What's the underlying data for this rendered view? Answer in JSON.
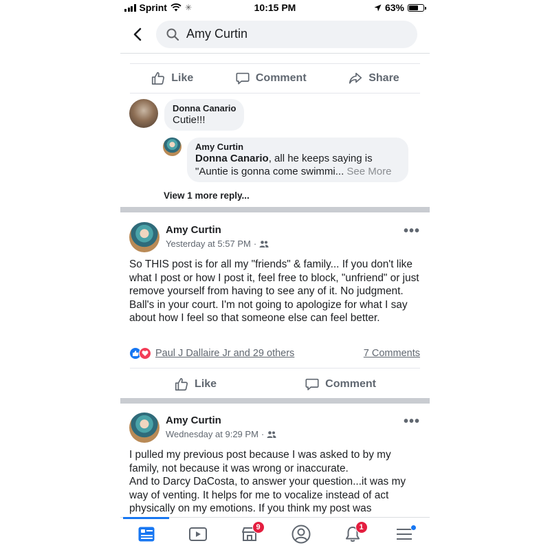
{
  "status_bar": {
    "carrier": "Sprint",
    "time": "10:15 PM",
    "battery": "63%",
    "battery_level": 0.63
  },
  "search": {
    "query": "Amy Curtin"
  },
  "top_post": {
    "actions": {
      "like": "Like",
      "comment": "Comment",
      "share": "Share"
    },
    "comment": {
      "author": "Donna Canario",
      "text": "Cutie!!!"
    },
    "reply": {
      "author": "Amy Curtin",
      "mention": "Donna Canario",
      "text_line1": ", all he keeps saying is",
      "text_line2": "\"Auntie is gonna come swimmi...",
      "see_more": "See More"
    },
    "view_more_replies": "View 1 more reply..."
  },
  "posts": [
    {
      "author": "Amy Curtin",
      "timestamp": "Yesterday at 5:57 PM",
      "audience_icon": "friends-icon",
      "text": "So THIS post is for all my \"friends\" & family... If you don't like what I post or how I post it, feel free to block, \"unfriend\" or just remove yourself from having to see any of it. No judgment. Ball's in your court. I'm not going to apologize for what I say about how I feel so that someone else can feel better.",
      "reactions_summary": "Paul J Dallaire Jr and 29 others",
      "comments_count": "7 Comments",
      "actions": {
        "like": "Like",
        "comment": "Comment"
      }
    },
    {
      "author": "Amy Curtin",
      "timestamp": "Wednesday at 9:29 PM",
      "audience_icon": "friends-icon",
      "text": "I pulled my previous post because I was asked to by my family, not because it was wrong or inaccurate.\nAnd to Darcy DaCosta, to answer your question...it was my way of venting. It helps for me to vocalize instead of act physically on my emotions. If you think my post was"
    }
  ],
  "tab_bar": {
    "tabs": [
      {
        "name": "news-feed",
        "icon": "news-feed-icon",
        "active": true
      },
      {
        "name": "watch",
        "icon": "video-play-icon"
      },
      {
        "name": "marketplace",
        "icon": "marketplace-icon",
        "badge": "9"
      },
      {
        "name": "profile",
        "icon": "profile-icon"
      },
      {
        "name": "notifications",
        "icon": "bell-icon",
        "badge": "1"
      },
      {
        "name": "menu",
        "icon": "hamburger-menu-icon"
      }
    ]
  },
  "colors": {
    "accent": "#1877f2",
    "badge": "#e41e3f",
    "secondary_text": "#606770"
  }
}
